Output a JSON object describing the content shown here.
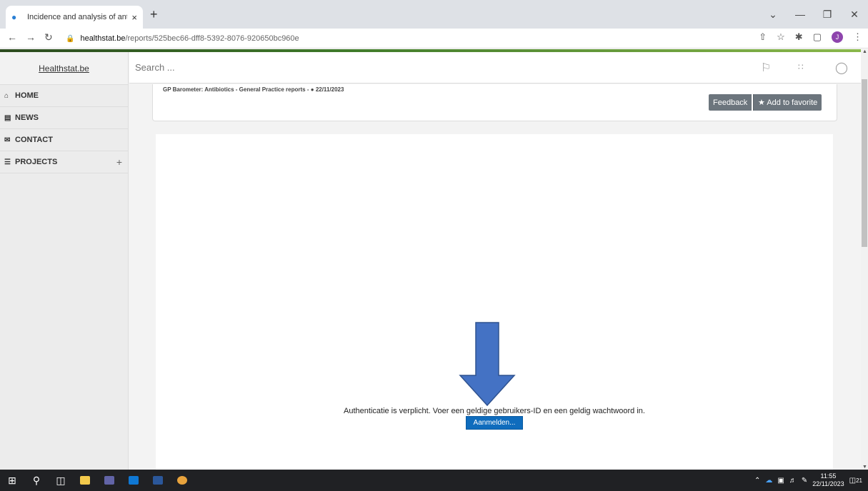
{
  "browser": {
    "tab_title": "Incidence and analysis of antibio",
    "tab_close": "×",
    "new_tab": "+",
    "url_host": "healthstat.be",
    "url_path": "/reports/525bec66-dff8-5392-8076-920650bc960e",
    "profile_initial": "J"
  },
  "sidebar": {
    "brand": "Healthstat.be",
    "items": [
      {
        "label": "HOME",
        "icon": "home-icon"
      },
      {
        "label": "NEWS",
        "icon": "news-icon"
      },
      {
        "label": "CONTACT",
        "icon": "envelope-icon"
      },
      {
        "label": "PROJECTS",
        "icon": "database-icon"
      }
    ],
    "projects_expand": "+"
  },
  "topbar": {
    "search_placeholder": "Search ..."
  },
  "report": {
    "title": "GP Barometer: Antibiotics - General Practice reports - ",
    "date": "22/11/2023",
    "feedback_label": "Feedback",
    "favorite_label": "Add to favorite"
  },
  "auth": {
    "message": "Authenticatie is verplicht. Voer een geldige gebruikers-ID en een geldig wachtwoord in.",
    "login_label": "Aanmelden..."
  },
  "annotation": {
    "arrow_color": "#4472c4"
  },
  "taskbar": {
    "time": "11:55",
    "date": "22/11/2023",
    "notifications": "21"
  },
  "colors": {
    "accent_button": "#6c757d",
    "login_button": "#0f6cbd",
    "header_green": "#3f7a2a"
  }
}
